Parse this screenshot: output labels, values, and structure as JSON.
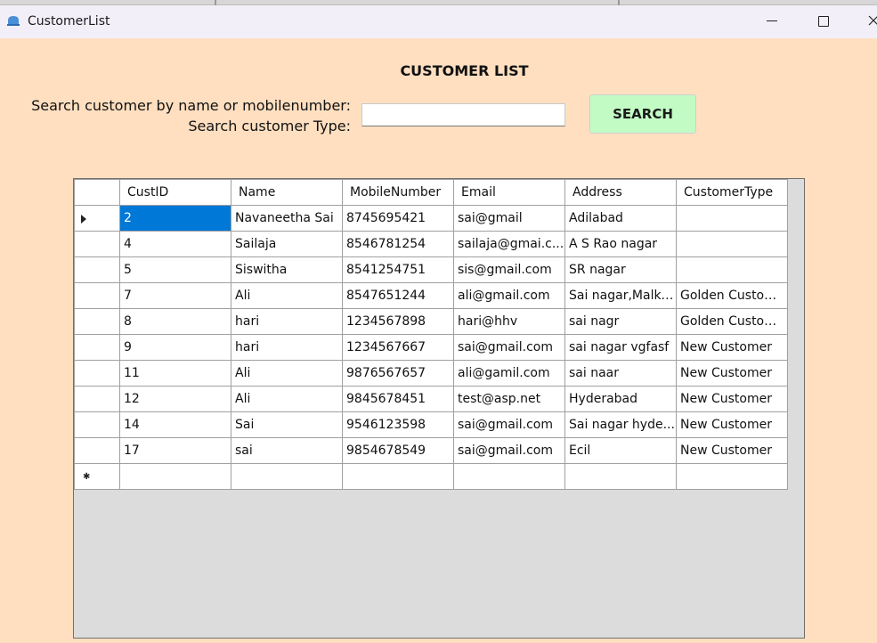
{
  "window": {
    "title": "CustomerList"
  },
  "header": {
    "title": "CUSTOMER LIST",
    "search_label": "Search customer by name or mobilenumber:",
    "type_label": "Search customer Type:",
    "search_value": "",
    "search_button": "SEARCH"
  },
  "grid": {
    "columns": [
      "CustID",
      "Name",
      "MobileNumber",
      "Email",
      "Address",
      "CustomerType"
    ],
    "rows": [
      [
        "2",
        "Navaneetha Sai",
        "8745695421",
        "sai@gmail",
        "Adilabad",
        ""
      ],
      [
        "4",
        "Sailaja",
        "8546781254",
        "sailaja@gmai.c...",
        "A S Rao nagar",
        ""
      ],
      [
        "5",
        "Siswitha",
        "8541254751",
        "sis@gmail.com",
        "SR nagar",
        ""
      ],
      [
        "7",
        "Ali",
        "8547651244",
        "ali@gmail.com",
        "Sai nagar,Malka...",
        "Golden Custom..."
      ],
      [
        "8",
        "hari",
        "1234567898",
        "hari@hhv",
        "sai nagr",
        "Golden Customer"
      ],
      [
        "9",
        "hari",
        "1234567667",
        "sai@gmail.com",
        "sai nagar vgfasf",
        "New Customer"
      ],
      [
        "11",
        "Ali",
        "9876567657",
        "ali@gamil.com",
        "sai naar",
        "New Customer"
      ],
      [
        "12",
        "Ali",
        "9845678451",
        "test@asp.net",
        "Hyderabad",
        "New Customer"
      ],
      [
        "14",
        "Sai",
        "9546123598",
        "sai@gmail.com",
        "Sai  nagar hyde...",
        "New Customer"
      ],
      [
        "17",
        "sai",
        "9854678549",
        "sai@gmail.com",
        "Ecil",
        "New Customer"
      ]
    ],
    "selected_row": 0,
    "selected_color": "#0078d7"
  },
  "colors": {
    "background": "#ffdfc0",
    "button": "#c2fcc4",
    "grid_empty": "#dcdcdc"
  },
  "icons": {
    "app": "app-window-icon",
    "minimize": "minimize-icon",
    "maximize": "maximize-icon",
    "close": "close-icon",
    "current_row": "row-pointer-icon",
    "new_row": "new-row-star-icon"
  }
}
